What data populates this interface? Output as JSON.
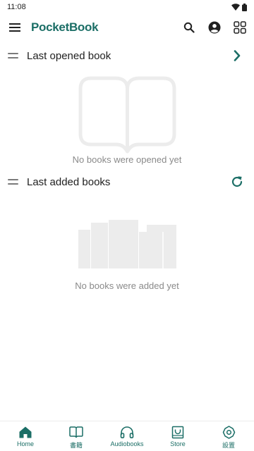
{
  "status_bar": {
    "time": "11:08"
  },
  "app_bar": {
    "brand": "PocketBook",
    "icons": [
      "menu-icon",
      "search-icon",
      "account-icon",
      "grid-view-icon"
    ]
  },
  "colors": {
    "accent": "#1b6e66",
    "placeholder": "#ececec",
    "muted_text": "#8a8a8a"
  },
  "sections": {
    "last_opened": {
      "title": "Last opened book",
      "empty_text": "No books were opened yet",
      "action_icon": "chevron-right-icon"
    },
    "last_added": {
      "title": "Last added books",
      "empty_text": "No books were added yet",
      "action_icon": "refresh-icon"
    }
  },
  "bottom_nav": {
    "items": [
      {
        "label": "Home",
        "icon": "home-icon",
        "active": true
      },
      {
        "label": "書籍",
        "icon": "book-icon"
      },
      {
        "label": "Audiobooks",
        "icon": "headphones-icon"
      },
      {
        "label": "Store",
        "icon": "store-bag-icon"
      },
      {
        "label": "設置",
        "icon": "settings-icon"
      }
    ]
  }
}
